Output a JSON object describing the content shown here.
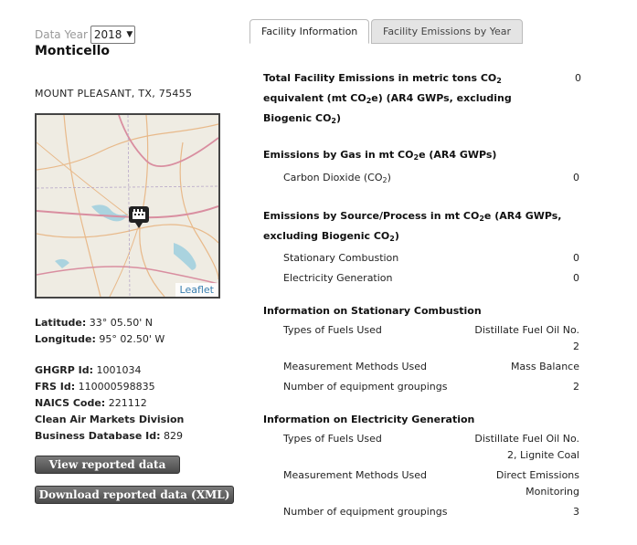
{
  "facility": {
    "data_year_label": "Data Year",
    "data_year": "2018",
    "name": "Monticello",
    "address": "MOUNT PLEASANT, TX, 75455",
    "latitude_label": "Latitude:",
    "latitude": "33° 05.50' N",
    "longitude_label": "Longitude:",
    "longitude": "95° 02.50' W",
    "ghgrp_label": "GHGRP Id:",
    "ghgrp_id": "1001034",
    "frs_label": "FRS Id:",
    "frs_id": "110000598835",
    "naics_label": "NAICS Code:",
    "naics_code": "221112",
    "camd_label": "Clean Air Markets Division",
    "bdb_label": "Business Database Id:",
    "bdb_id": "829",
    "map_attribution": "Leaflet"
  },
  "buttons": {
    "view": "View reported data",
    "download": "Download reported data (XML)"
  },
  "tabs": [
    {
      "label": "Facility Information",
      "active": true
    },
    {
      "label": "Facility Emissions by Year",
      "active": false
    }
  ],
  "emissions": {
    "total_line1": "Total Facility Emissions in metric tons CO",
    "total_line2a": "equivalent (mt CO",
    "total_line2b": "e) (AR4 GWPs, excluding",
    "total_line3": "Biogenic CO",
    "total_value": "0",
    "by_gas_title_a": "Emissions by Gas in mt CO",
    "by_gas_title_b": "e (AR4 GWPs)",
    "co2_label_a": "Carbon Dioxide (CO",
    "co2_label_b": ")",
    "co2_value": "0",
    "by_source_line1a": "Emissions by Source/Process in mt CO",
    "by_source_line1b": "e (AR4 GWPs,",
    "by_source_line2a": "excluding Biogenic CO",
    "by_source_line2b": ")",
    "stationary_label": "Stationary Combustion",
    "stationary_value": "0",
    "electricity_label": "Electricity Generation",
    "electricity_value": "0",
    "sub2": "2"
  },
  "stationary_info": {
    "title": "Information on Stationary Combustion",
    "fuels_label": "Types of Fuels Used",
    "fuels_value_1": "Distillate Fuel Oil No.",
    "fuels_value_2": "2",
    "methods_label": "Measurement Methods Used",
    "methods_value": "Mass Balance",
    "groupings_label": "Number of equipment groupings",
    "groupings_value": "2"
  },
  "electricity_info": {
    "title": "Information on Electricity Generation",
    "fuels_label": "Types of Fuels Used",
    "fuels_value_1": "Distillate Fuel Oil No.",
    "fuels_value_2": "2, Lignite Coal",
    "methods_label": "Measurement Methods Used",
    "methods_value_1": "Direct Emissions",
    "methods_value_2": "Monitoring",
    "groupings_label": "Number of equipment groupings",
    "groupings_value": "3"
  }
}
